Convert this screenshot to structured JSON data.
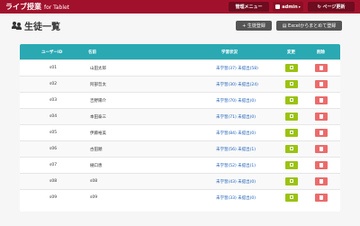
{
  "navbar": {
    "brand": "ライブ授業",
    "brand_sub": "for Tablet",
    "menu_label": "管理メニュー",
    "admin_label": "admin",
    "refresh_label": "ページ更新"
  },
  "page": {
    "title": "生徒一覧",
    "add_button": "+ 生徒登録",
    "excel_button": "Excelからまとめて登録"
  },
  "table": {
    "headers": {
      "user_id": "ユーザーID",
      "name": "名前",
      "status": "学習状況",
      "edit": "変更",
      "delete": "削除"
    },
    "rows": [
      {
        "user_id": "s01",
        "name": "山田太郎",
        "status": "未学習(37) 未提出(58)"
      },
      {
        "user_id": "s02",
        "name": "阿部哲太",
        "status": "未学習(30) 未提出(24)"
      },
      {
        "user_id": "s03",
        "name": "吉野陽介",
        "status": "未学習(70) 未提出(0)"
      },
      {
        "user_id": "s04",
        "name": "本田泰三",
        "status": "未学習(71) 未提出(0)"
      },
      {
        "user_id": "s05",
        "name": "伊藤裕美",
        "status": "未学習(84) 未提出(0)"
      },
      {
        "user_id": "s06",
        "name": "古田順",
        "status": "未学習(56) 未提出(1)"
      },
      {
        "user_id": "s07",
        "name": "樋口恵",
        "status": "未学習(52) 未提出(1)"
      },
      {
        "user_id": "s08",
        "name": "s08",
        "status": "未学習(43) 未提出(0)"
      },
      {
        "user_id": "s09",
        "name": "s09",
        "status": "未学習(33) 未提出(0)"
      }
    ]
  }
}
